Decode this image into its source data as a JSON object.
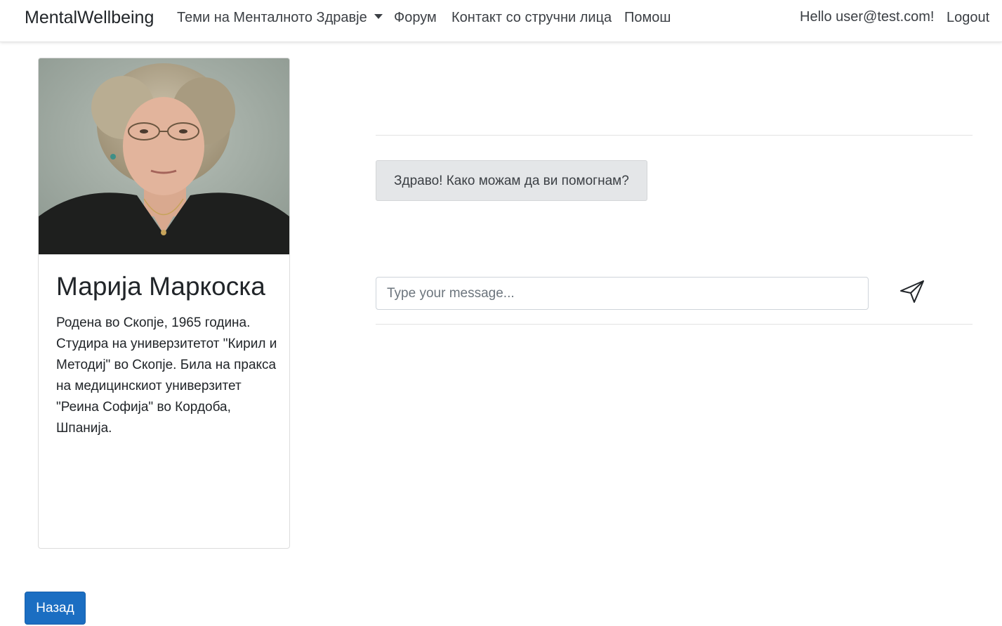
{
  "navbar": {
    "brand": "MentalWellbeing",
    "items": [
      {
        "label": "Теми на Менталното Здравје"
      },
      {
        "label": "Форум"
      },
      {
        "label": "Контакт со стручни лица"
      },
      {
        "label": "Помош"
      }
    ],
    "greeting": "Hello user@test.com!",
    "logout": "Logout"
  },
  "profile": {
    "name": "Марија Маркоска",
    "bio": "Родена во Скопје, 1965 година. Студира на универзитетот \"Кирил и Методиј\" во Скопје. Била на пракса на медицинскиот универзитет \"Реина Софија\" во Кордоба, Шпанија."
  },
  "chat": {
    "messages": [
      {
        "text": "Здраво! Како можам да ви помогнам?"
      }
    ],
    "input_placeholder": "Type your message...",
    "input_value": ""
  },
  "back_button": "Назад",
  "colors": {
    "primary": "#1b6ec2",
    "bubble_bg": "#e4e6e8",
    "photo_bg": "#9aa59c"
  },
  "icons": {
    "send": "send-icon",
    "dropdown": "chevron-down-icon",
    "photo": "profile-photo"
  }
}
